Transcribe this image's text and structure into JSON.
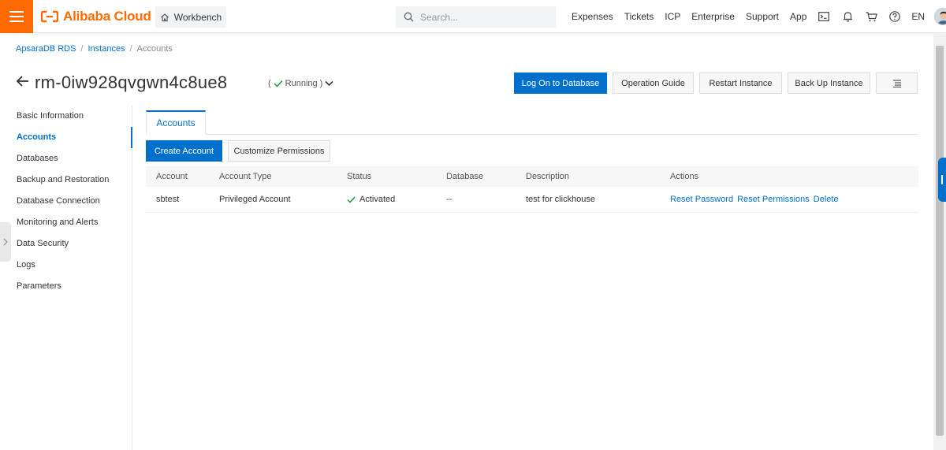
{
  "header": {
    "logo_text": "Alibaba Cloud",
    "workbench_label": "Workbench",
    "search_placeholder": "Search...",
    "nav_links": [
      "Expenses",
      "Tickets",
      "ICP",
      "Enterprise",
      "Support",
      "App"
    ],
    "lang": "EN",
    "brand_color": "#ff6a00"
  },
  "breadcrumb": {
    "items": [
      "ApsaraDB RDS",
      "Instances",
      "Accounts"
    ],
    "separator": "/"
  },
  "instance": {
    "title": "rm-0iw928qvgwn4c8ue8",
    "status_open": "(",
    "status": "Running",
    "status_close": ")"
  },
  "actions": {
    "log_on": "Log On to Database",
    "operation_guide": "Operation Guide",
    "restart": "Restart Instance",
    "backup": "Back Up Instance"
  },
  "sidenav": {
    "items": [
      "Basic Information",
      "Accounts",
      "Databases",
      "Backup and Restoration",
      "Database Connection",
      "Monitoring and Alerts",
      "Data Security",
      "Logs",
      "Parameters"
    ],
    "active_index": 1
  },
  "tabs": {
    "active": "Accounts"
  },
  "toolbar": {
    "create_account": "Create Account",
    "customize_permissions": "Customize Permissions"
  },
  "table": {
    "headers": [
      "Account",
      "Account Type",
      "Status",
      "Database",
      "Description",
      "Actions"
    ],
    "rows": [
      {
        "account": "sbtest",
        "type": "Privileged Account",
        "status": "Activated",
        "database": "--",
        "description": "test for clickhouse",
        "actions": [
          "Reset Password",
          "Reset Permissions",
          "Delete"
        ]
      }
    ]
  },
  "colors": {
    "primary": "#0070cc",
    "success": "#1a9c3e"
  }
}
